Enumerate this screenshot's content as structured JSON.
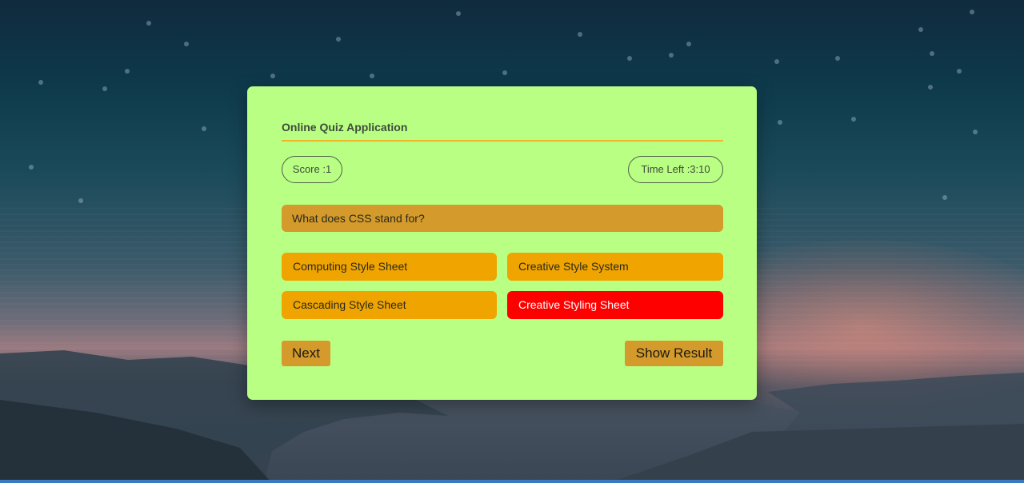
{
  "quiz": {
    "title": "Online Quiz Application",
    "score_label": "Score :1",
    "timer_label": "Time Left :3:10",
    "question": "What does CSS stand for?",
    "options": [
      {
        "label": "Computing Style Sheet",
        "state": "default"
      },
      {
        "label": "Creative Style System",
        "state": "default"
      },
      {
        "label": "Cascading Style Sheet",
        "state": "default"
      },
      {
        "label": "Creative Styling Sheet",
        "state": "wrong"
      }
    ],
    "next_label": "Next",
    "show_result_label": "Show Result"
  },
  "colors": {
    "card": "#b9ff84",
    "accent_rule": "#f0b429",
    "question_bg": "#d49a2b",
    "option_bg": "#f0a400",
    "wrong_option_bg": "#ff0000",
    "button_bg": "#d49a2b"
  }
}
